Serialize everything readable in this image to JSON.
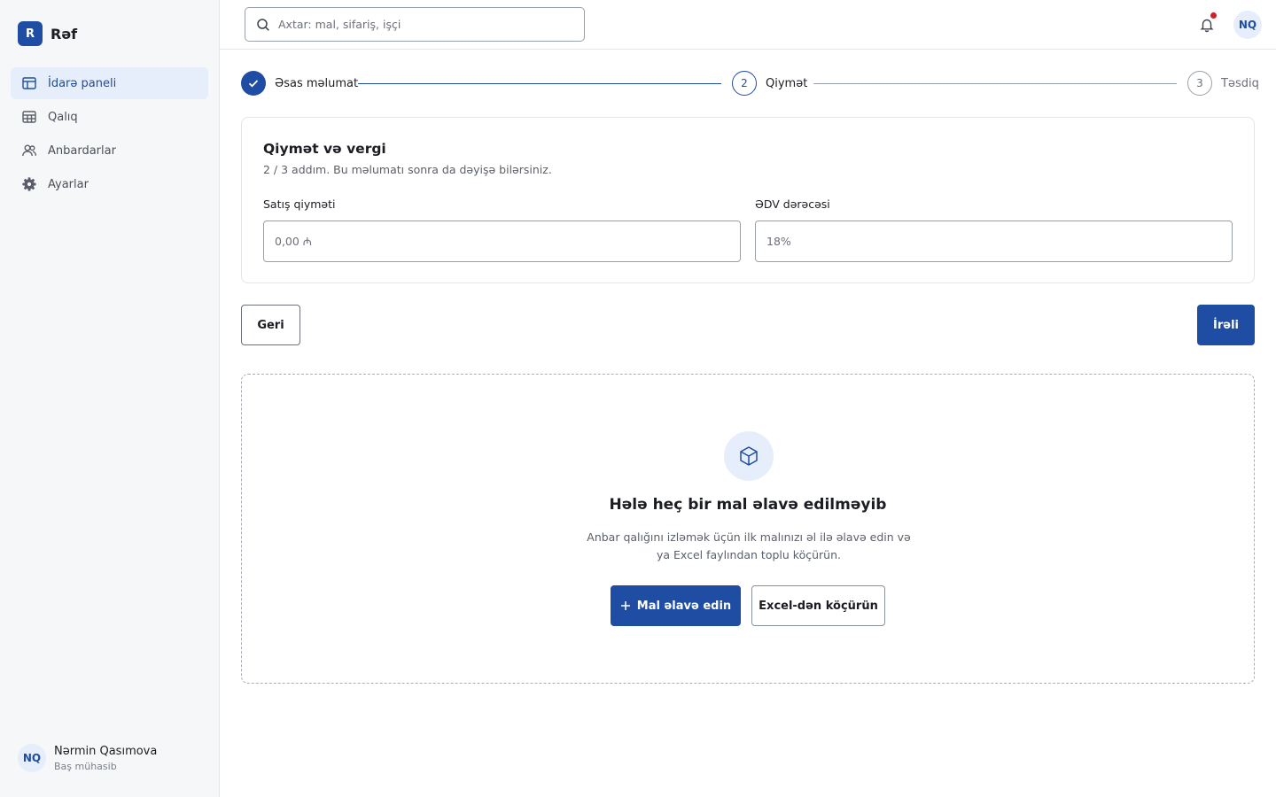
{
  "brand": {
    "logo_letter": "R",
    "name": "Rəf"
  },
  "sidebar": {
    "items": [
      {
        "label": "İdarə paneli",
        "icon": "layout-icon",
        "active": true
      },
      {
        "label": "Qalıq",
        "icon": "table-icon",
        "active": false
      },
      {
        "label": "Anbardarlar",
        "icon": "users-icon",
        "active": false
      },
      {
        "label": "Ayarlar",
        "icon": "gear-icon",
        "active": false
      }
    ],
    "user": {
      "initials": "NQ",
      "name": "Nərmin Qasımova",
      "role": "Baş mühasib"
    }
  },
  "header": {
    "search_placeholder": "Axtar: mal, sifariş, işçi",
    "notification_dot": true,
    "avatar_initials": "NQ"
  },
  "stepper": {
    "steps": [
      {
        "label": "Əsas məlumat",
        "status": "done"
      },
      {
        "number": "2",
        "label": "Qiymət",
        "status": "current"
      },
      {
        "number": "3",
        "label": "Təsdiq",
        "status": "upcoming"
      }
    ]
  },
  "form": {
    "title": "Qiymət və vergi",
    "subtitle": "2 / 3 addım. Bu məlumatı sonra da dəyişə bilərsiniz.",
    "price_label": "Satış qiyməti",
    "price_placeholder": "0,00 ₼",
    "vat_label": "ƏDV dərəcəsi",
    "vat_value": "18%"
  },
  "actions": {
    "back_label": "Geri",
    "next_label": "İrəli"
  },
  "empty_state": {
    "title": "Hələ heç bir mal əlavə edilməyib",
    "text_line1": "Anbar qalığını izləmək üçün ilk malınızı əl ilə əlavə edin və",
    "text_line2": "ya Excel faylından toplu köçürün.",
    "add_label": "Mal əlavə edin",
    "import_label": "Excel-dən köçürün"
  },
  "colors": {
    "accent": "#1e4da3",
    "accent_soft": "#e6eefb",
    "notification": "#c8242c"
  }
}
